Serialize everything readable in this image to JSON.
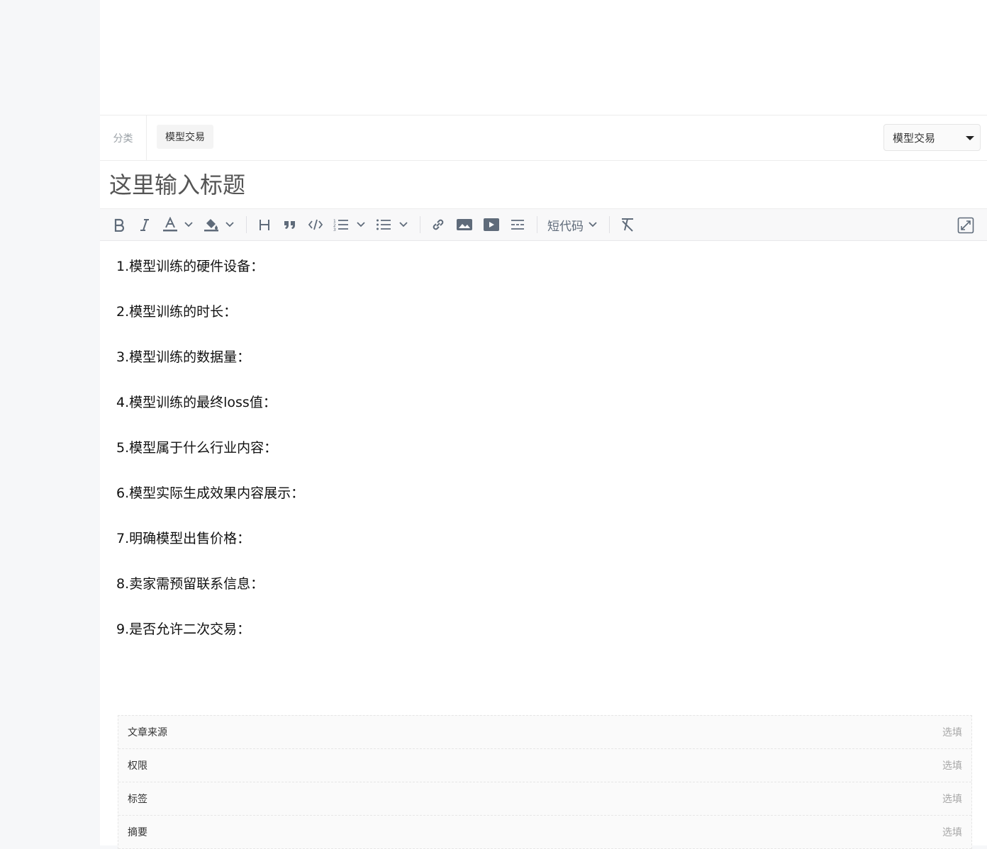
{
  "category": {
    "label": "分类",
    "chip": "模型交易",
    "selected": "模型交易"
  },
  "title": {
    "placeholder": "这里输入标题"
  },
  "toolbar": {
    "shortcode_label": "短代码"
  },
  "content": {
    "lines": [
      "1.模型训练的硬件设备：",
      "2.模型训练的时长：",
      "3.模型训练的数据量：",
      "4.模型训练的最终loss值：",
      "5.模型属于什么行业内容：",
      "6.模型实际生成效果内容展示：",
      "7.明确模型出售价格：",
      "8.卖家需预留联系信息：",
      "9.是否允许二次交易："
    ]
  },
  "meta": {
    "rows": [
      {
        "key": "文章来源",
        "hint": "选填"
      },
      {
        "key": "权限",
        "hint": "选填"
      },
      {
        "key": "标签",
        "hint": "选填"
      },
      {
        "key": "摘要",
        "hint": "选填"
      }
    ]
  },
  "colors": {
    "icon": "#5f6b7a",
    "border": "#ececec",
    "sidebar_bg": "#f6f7f9"
  }
}
